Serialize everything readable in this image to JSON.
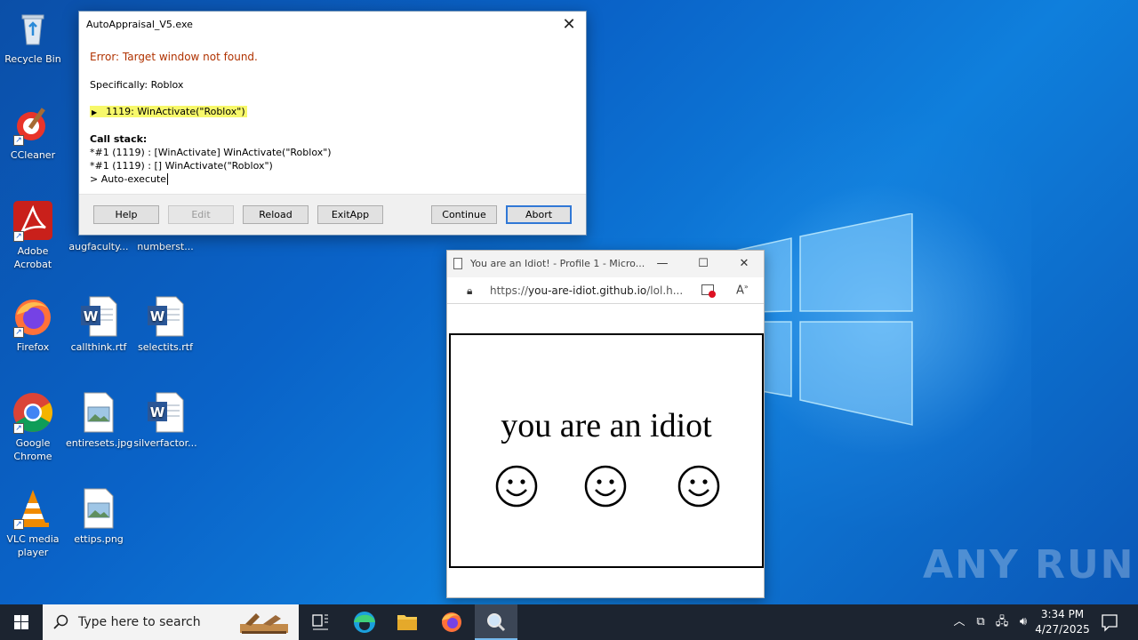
{
  "desktop": {
    "icons": [
      {
        "label": "Recycle Bin",
        "icon": "recycle-bin-icon"
      },
      {
        "label": "CCleaner",
        "icon": "ccleaner-icon"
      },
      {
        "label": "Adobe Acrobat",
        "icon": "acrobat-icon"
      },
      {
        "label": "augfaculty...",
        "icon": "file-icon"
      },
      {
        "label": "numberst...",
        "icon": "file-icon"
      },
      {
        "label": "Firefox",
        "icon": "firefox-icon"
      },
      {
        "label": "callthink.rtf",
        "icon": "word-doc-icon"
      },
      {
        "label": "selectits.rtf",
        "icon": "word-doc-icon"
      },
      {
        "label": "Google Chrome",
        "icon": "chrome-icon"
      },
      {
        "label": "entiresets.jpg",
        "icon": "image-file-icon"
      },
      {
        "label": "silverfactor...",
        "icon": "word-doc-icon"
      },
      {
        "label": "VLC media player",
        "icon": "vlc-icon"
      },
      {
        "label": "ettips.png",
        "icon": "image-file-icon"
      }
    ]
  },
  "error_dialog": {
    "title": "AutoAppraisal_V5.exe",
    "close_glyph": "✕",
    "error_message": "Error: Target window not found.",
    "specifically": "Specifically: Roblox",
    "highlight_line": "1119: WinActivate(\"Roblox\")",
    "call_stack_header": "Call stack:",
    "call_stack": [
      "*#1 (1119) : [WinActivate] WinActivate(\"Roblox\")",
      "*#1 (1119) : [] WinActivate(\"Roblox\")",
      "> Auto-execute"
    ],
    "buttons": {
      "help": "Help",
      "edit": "Edit",
      "reload": "Reload",
      "exitapp": "ExitApp",
      "continue": "Continue",
      "abort": "Abort"
    }
  },
  "browser": {
    "tab_title": "You are an Idiot! - Profile 1 - Micro...",
    "url_proto": "https://",
    "url_host": "you-are-idiot.github.io",
    "url_path": "/lol.h...",
    "page_text": "you are an idiot",
    "smiley_glyph": "☺"
  },
  "watermark": "ANY RUN",
  "taskbar": {
    "search_placeholder": "Type here to search",
    "time": "3:34 PM",
    "date": "4/27/2025",
    "accent": "#76b9ed"
  }
}
